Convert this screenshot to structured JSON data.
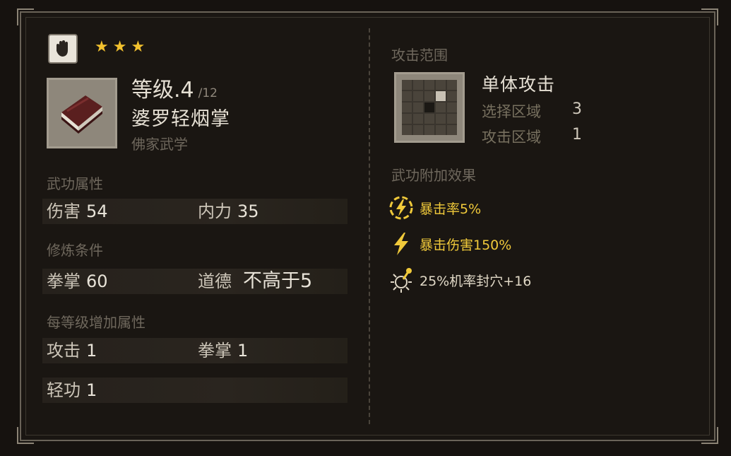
{
  "skill": {
    "stars": 3,
    "level_label": "等级",
    "level_value": ".4",
    "level_max": "/12",
    "name": "婆罗轻烟掌",
    "school": "佛家武学"
  },
  "attributes": {
    "title": "武功属性",
    "items": [
      {
        "label": "伤害",
        "value": "54"
      },
      {
        "label": "内力",
        "value": "35"
      }
    ]
  },
  "requirements": {
    "title": "修炼条件",
    "items": [
      {
        "label": "拳掌",
        "value": "60"
      },
      {
        "label": "道德",
        "value": "不高于5"
      }
    ]
  },
  "per_level": {
    "title": "每等级增加属性",
    "items": [
      {
        "label": "攻击",
        "value": "1"
      },
      {
        "label": "拳掌",
        "value": "1"
      },
      {
        "label": "轻功",
        "value": "1"
      }
    ]
  },
  "range": {
    "title": "攻击范围",
    "attack_type": "单体攻击",
    "select_label": "选择区域",
    "select_value": "3",
    "attack_label": "攻击区域",
    "attack_value": "1"
  },
  "effects": {
    "title": "武功附加效果",
    "items": [
      {
        "icon": "crit-rate-icon",
        "text": "暴击率5%"
      },
      {
        "icon": "crit-damage-icon",
        "text": "暴击伤害150%"
      },
      {
        "icon": "seal-acupoint-icon",
        "text": "25%机率封穴+16"
      }
    ]
  },
  "colors": {
    "star": "#f2c12e",
    "effect_text": "#f0c93a",
    "panel_bg": "#1a1612"
  }
}
